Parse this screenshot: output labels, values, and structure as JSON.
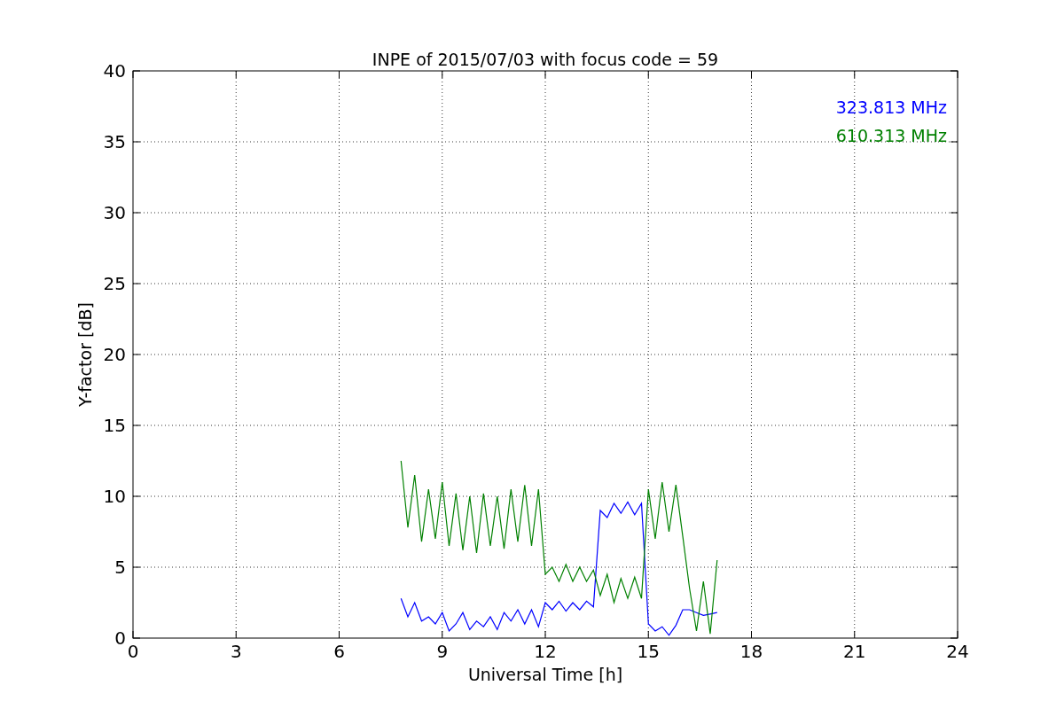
{
  "chart_data": {
    "type": "line",
    "title": "INPE of 2015/07/03 with focus code = 59",
    "xlabel": "Universal Time [h]",
    "ylabel": "Y-factor [dB]",
    "x": [
      7.8,
      8.0,
      8.2,
      8.4,
      8.6,
      8.8,
      9.0,
      9.2,
      9.4,
      9.6,
      9.8,
      10.0,
      10.2,
      10.4,
      10.6,
      10.8,
      11.0,
      11.2,
      11.4,
      11.6,
      11.8,
      12.0,
      12.2,
      12.4,
      12.6,
      12.8,
      13.0,
      13.2,
      13.4,
      13.6,
      13.8,
      14.0,
      14.2,
      14.4,
      14.6,
      14.8,
      15.0,
      15.2,
      15.4,
      15.6,
      15.8,
      16.0,
      16.2,
      16.4,
      16.6,
      16.8,
      17.0
    ],
    "series": [
      {
        "name": "323.813 MHz",
        "color": "#0000ff",
        "values": [
          2.8,
          1.5,
          2.5,
          1.2,
          1.5,
          1.0,
          1.8,
          0.5,
          1.0,
          1.8,
          0.6,
          1.2,
          0.8,
          1.5,
          0.6,
          1.8,
          1.2,
          2.0,
          1.0,
          2.0,
          0.8,
          2.5,
          2.0,
          2.6,
          1.9,
          2.5,
          2.0,
          2.6,
          2.2,
          9.0,
          8.5,
          9.5,
          8.8,
          9.6,
          8.7,
          9.5,
          1.0,
          0.5,
          0.8,
          0.2,
          0.9,
          2.0,
          2.0,
          1.8,
          1.6,
          1.7,
          1.8
        ]
      },
      {
        "name": "610.313 MHz",
        "color": "#008000",
        "values": [
          12.5,
          7.8,
          11.5,
          6.8,
          10.5,
          7.0,
          11.0,
          6.5,
          10.2,
          6.2,
          10.0,
          6.0,
          10.2,
          6.5,
          10.0,
          6.3,
          10.5,
          6.8,
          10.8,
          6.5,
          10.5,
          4.5,
          5.0,
          4.0,
          5.2,
          4.0,
          5.0,
          4.0,
          4.8,
          3.0,
          4.5,
          2.5,
          4.2,
          2.8,
          4.3,
          2.8,
          10.5,
          7.0,
          11.0,
          7.5,
          10.8,
          7.2,
          3.5,
          0.5,
          4.0,
          0.3,
          5.5
        ]
      }
    ],
    "grid": true,
    "xlim": [
      0,
      24
    ],
    "ylim": [
      0,
      40
    ],
    "xticks": [
      0,
      3,
      6,
      9,
      12,
      15,
      18,
      21,
      24
    ],
    "yticks": [
      0,
      5,
      10,
      15,
      20,
      25,
      30,
      35,
      40
    ]
  }
}
